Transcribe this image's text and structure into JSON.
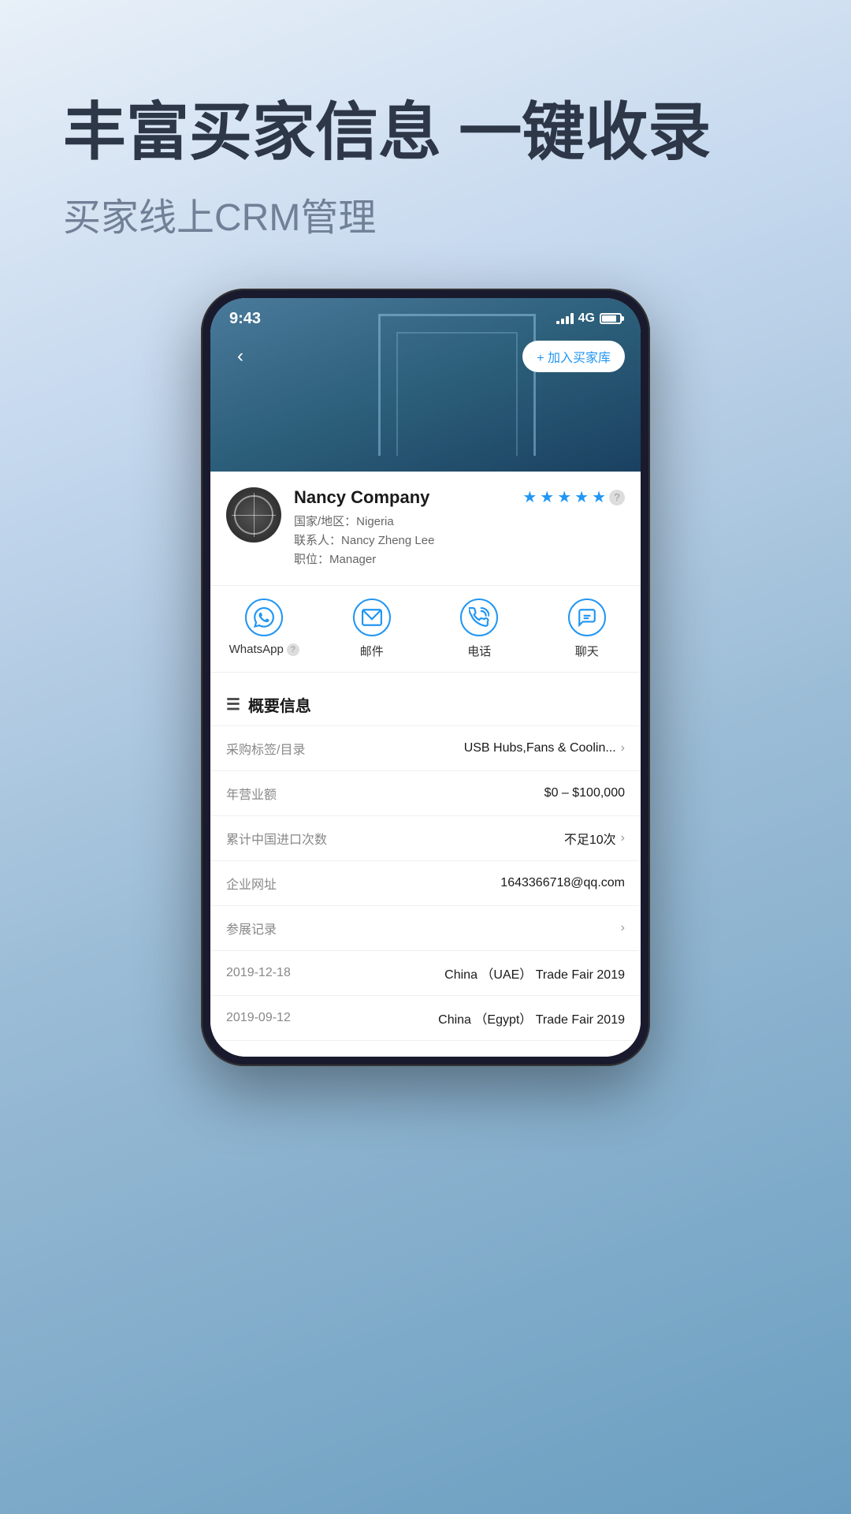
{
  "header": {
    "main_title": "丰富买家信息 一键收录",
    "sub_title": "买家线上CRM管理"
  },
  "phone": {
    "status_bar": {
      "time": "9:43",
      "signal": "4G"
    },
    "nav": {
      "add_button": "+ 加入买家库"
    },
    "contact": {
      "name": "Nancy Company",
      "country_label": "国家/地区：",
      "country": "Nigeria",
      "contact_label": "联系人：",
      "contact_person": "Nancy Zheng Lee",
      "position_label": "职位：",
      "position": "Manager",
      "stars": 5,
      "half_star": false
    },
    "actions": [
      {
        "id": "whatsapp",
        "label": "WhatsApp",
        "has_help": true,
        "icon": "whatsapp"
      },
      {
        "id": "email",
        "label": "邮件",
        "has_help": false,
        "icon": "email"
      },
      {
        "id": "phone",
        "label": "电话",
        "has_help": false,
        "icon": "phone"
      },
      {
        "id": "chat",
        "label": "聊天",
        "has_help": false,
        "icon": "chat"
      }
    ],
    "overview": {
      "title": "概要信息",
      "rows": [
        {
          "label": "采购标签/目录",
          "value": "USB Hubs,Fans & Coolin...",
          "has_chevron": true
        },
        {
          "label": "年营业额",
          "value": "$0 – $100,000",
          "has_chevron": false
        },
        {
          "label": "累计中国进口次数",
          "value": "不足10次",
          "has_chevron": true
        },
        {
          "label": "企业网址",
          "value": "1643366718@qq.com",
          "has_chevron": false
        },
        {
          "label": "参展记录",
          "value": "",
          "has_chevron": true
        },
        {
          "label": "2019-12-18",
          "value": "China （UAE） Trade Fair 2019",
          "has_chevron": false
        },
        {
          "label": "2019-09-12",
          "value": "China （Egypt） Trade Fair 2019",
          "has_chevron": false
        }
      ]
    }
  },
  "colors": {
    "primary_blue": "#2196F3",
    "text_dark": "#1a1a1a",
    "text_gray": "#888888",
    "bg_light": "#f8fafc"
  }
}
